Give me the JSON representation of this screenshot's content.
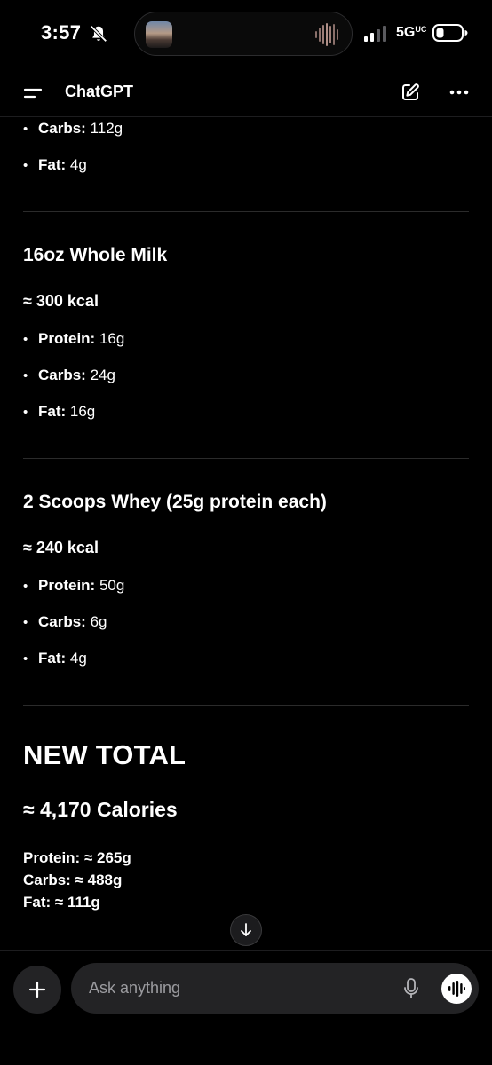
{
  "status_bar": {
    "time": "3:57",
    "network": "5G",
    "network_sub": "UC"
  },
  "header": {
    "title": "ChatGPT"
  },
  "content": {
    "top_items": [
      {
        "label": "Carbs:",
        "value": " 112g"
      },
      {
        "label": "Fat:",
        "value": " 4g"
      }
    ],
    "milk": {
      "title": "16oz Whole Milk",
      "kcal": "≈ 300 kcal",
      "items": [
        {
          "label": "Protein:",
          "value": " 16g"
        },
        {
          "label": "Carbs:",
          "value": " 24g"
        },
        {
          "label": "Fat:",
          "value": " 16g"
        }
      ]
    },
    "whey": {
      "title": "2 Scoops Whey (25g protein each)",
      "kcal": "≈ 240 kcal",
      "items": [
        {
          "label": "Protein:",
          "value": " 50g"
        },
        {
          "label": "Carbs:",
          "value": " 6g"
        },
        {
          "label": "Fat:",
          "value": " 4g"
        }
      ]
    },
    "total": {
      "title": "NEW TOTAL",
      "calories": "≈ 4,170 Calories",
      "lines": [
        "Protein: ≈ 265g",
        "Carbs: ≈ 488g",
        "Fat: ≈ 111g"
      ]
    }
  },
  "composer": {
    "placeholder": "Ask anything"
  },
  "colors": {
    "background": "#000000",
    "text": "#ffffff",
    "pill": "#232325",
    "divider": "#2b2b2b",
    "placeholder": "#9b9b9f"
  }
}
